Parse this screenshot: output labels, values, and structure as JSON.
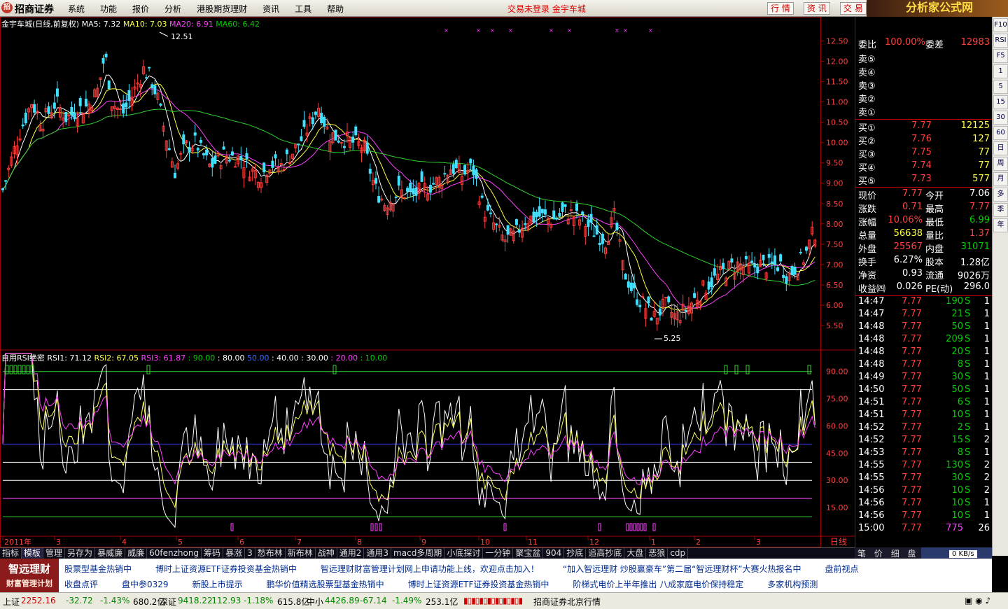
{
  "app": {
    "brand": "招商证券",
    "menu": [
      "系统",
      "功能",
      "报价",
      "分析",
      "港股期货理财",
      "资讯",
      "工具",
      "帮助"
    ],
    "status": "交易未登录  金宇车城",
    "buttons": [
      "行 情",
      "资 讯",
      "交 易"
    ],
    "ad_title": "分析家公式网",
    "ad_url": "www.88gs.com"
  },
  "kline": {
    "header": "金宇车城(日线,前复权)",
    "ma5": "MA5: 7.32",
    "ma10": "MA10: 7.03",
    "ma20": "MA20: 6.91",
    "ma60": "MA60: 6.42",
    "high_label": "12.51",
    "low_label": "5.25",
    "price_ticks": [
      "12.50",
      "12.00",
      "11.50",
      "11.00",
      "10.50",
      "10.00",
      "9.50",
      "9.00",
      "8.50",
      "8.00",
      "7.50",
      "7.00",
      "6.50",
      "6.00",
      "5.50"
    ],
    "colors": {
      "up": "#ff3c3c",
      "down": "#40e0ff",
      "ma5": "#ffffff",
      "ma10": "#ffff40",
      "ma20": "#ff40ff",
      "ma60": "#30d030"
    }
  },
  "rsi": {
    "name": "自用RSI绝密",
    "rsi1": "RSI1: 71.12",
    "rsi2": "RSI2: 67.05",
    "rsi3": "RSI3: 61.87",
    "levels": [
      ": 90.00",
      ": 80.00",
      "50.00",
      ": 40.00",
      ": 30.00",
      ": 20.00",
      ": 10.00"
    ],
    "ticks": [
      "90.00",
      "75.00",
      "60.00",
      "45.00",
      "30.00",
      "15.00"
    ]
  },
  "time_axis": [
    "2011年",
    "3",
    "4",
    "5",
    "6",
    "7",
    "8",
    "9",
    "10",
    "11",
    "12",
    "1",
    "2",
    "3"
  ],
  "time_axis_right": "日线",
  "side": {
    "weibi_label": "委比",
    "weibi": "100.00%",
    "weicha_label": "委差",
    "weicha": "12983",
    "sell": [
      {
        "label": "卖⑤"
      },
      {
        "label": "卖④"
      },
      {
        "label": "卖③"
      },
      {
        "label": "卖②"
      },
      {
        "label": "卖①"
      }
    ],
    "buy": [
      {
        "label": "买①",
        "price": "7.77",
        "vol": "12125"
      },
      {
        "label": "买②",
        "price": "7.76",
        "vol": "127"
      },
      {
        "label": "买③",
        "price": "7.75",
        "vol": "77"
      },
      {
        "label": "买④",
        "price": "7.74",
        "vol": "77"
      },
      {
        "label": "买⑤",
        "price": "7.73",
        "vol": "577"
      }
    ],
    "stats": [
      {
        "l1": "现价",
        "v1": "7.77",
        "l2": "今开",
        "v2": "7.06",
        "c1": "red",
        "c2": "wht"
      },
      {
        "l1": "涨跌",
        "v1": "0.71",
        "l2": "最高",
        "v2": "7.77",
        "c1": "red",
        "c2": "red"
      },
      {
        "l1": "涨幅",
        "v1": "10.06%",
        "l2": "最低",
        "v2": "6.99",
        "c1": "red",
        "c2": "grn"
      },
      {
        "l1": "总量",
        "v1": "56638",
        "l2": "量比",
        "v2": "1.37",
        "c1": "yel",
        "c2": "red"
      },
      {
        "l1": "外盘",
        "v1": "25567",
        "l2": "内盘",
        "v2": "31071",
        "c1": "red",
        "c2": "grn"
      },
      {
        "l1": "换手",
        "v1": "6.27%",
        "l2": "股本",
        "v2": "1.28亿",
        "c1": "wht",
        "c2": "wht"
      },
      {
        "l1": "净资",
        "v1": "0.93",
        "l2": "流通",
        "v2": "9026万",
        "c1": "wht",
        "c2": "wht"
      },
      {
        "l1": "收益㈣",
        "v1": "0.026",
        "l2": "PE(动)",
        "v2": "296.0",
        "c1": "wht",
        "c2": "wht"
      }
    ],
    "ticks": [
      {
        "t": "14:47",
        "p": "7.77",
        "v": "190",
        "s": "S",
        "n": "1"
      },
      {
        "t": "14:47",
        "p": "7.77",
        "v": "21",
        "s": "S",
        "n": "1"
      },
      {
        "t": "14:48",
        "p": "7.77",
        "v": "50",
        "s": "S",
        "n": "1"
      },
      {
        "t": "14:48",
        "p": "7.77",
        "v": "209",
        "s": "S",
        "n": "1"
      },
      {
        "t": "14:48",
        "p": "7.77",
        "v": "20",
        "s": "S",
        "n": "1"
      },
      {
        "t": "14:48",
        "p": "7.77",
        "v": "8",
        "s": "S",
        "n": "1"
      },
      {
        "t": "14:49",
        "p": "7.77",
        "v": "30",
        "s": "S",
        "n": "1"
      },
      {
        "t": "14:50",
        "p": "7.77",
        "v": "50",
        "s": "S",
        "n": "1"
      },
      {
        "t": "14:51",
        "p": "7.77",
        "v": "6",
        "s": "S",
        "n": "1"
      },
      {
        "t": "14:51",
        "p": "7.77",
        "v": "10",
        "s": "S",
        "n": "1"
      },
      {
        "t": "14:52",
        "p": "7.77",
        "v": "2",
        "s": "S",
        "n": "1"
      },
      {
        "t": "14:52",
        "p": "7.77",
        "v": "15",
        "s": "S",
        "n": "2"
      },
      {
        "t": "14:53",
        "p": "7.77",
        "v": "8",
        "s": "S",
        "n": "1"
      },
      {
        "t": "14:55",
        "p": "7.77",
        "v": "130",
        "s": "S",
        "n": "2"
      },
      {
        "t": "14:55",
        "p": "7.77",
        "v": "30",
        "s": "S",
        "n": "2"
      },
      {
        "t": "14:56",
        "p": "7.77",
        "v": "10",
        "s": "S",
        "n": "2"
      },
      {
        "t": "14:56",
        "p": "7.77",
        "v": "10",
        "s": "S",
        "n": "1"
      },
      {
        "t": "14:56",
        "p": "7.77",
        "v": "10",
        "s": "S",
        "n": "1"
      },
      {
        "t": "15:00",
        "p": "7.77",
        "v": "775",
        "s": "",
        "n": "26"
      }
    ]
  },
  "right_toolbar": [
    "F10",
    "RSI",
    "F5",
    "1",
    "5",
    "15",
    "30",
    "60",
    "日",
    "周",
    "月",
    "多",
    "季",
    "年"
  ],
  "bottom_tabs": [
    "指标",
    "模板",
    "管理",
    "另存为",
    "暴威廉",
    "威廉",
    "60fenzhong",
    "筹码",
    "暴涨",
    "3",
    "愁布林",
    "新布林",
    "战神",
    "通用2",
    "通用3",
    "macd多周期",
    "小底探讨",
    "一分钟",
    "聚宝盆",
    "904",
    "抄底",
    "追高抄底",
    "大盘",
    "恶狼",
    "cdp"
  ],
  "side_tabs": [
    "笔",
    "价",
    "细",
    "盘"
  ],
  "speed": "0 KB/s",
  "news": {
    "logo": "智远理财",
    "logo_sub": "财富管理计划",
    "line1": [
      "股票型基金热销中",
      "博时上证资源ETF证券投资基金热销中",
      "智远理财财富管理计划网上申请功能上线，欢迎点击加入！",
      "“加入智远理财 炒股赢豪车”第二届“智远理财杯”大赛火热报名中",
      "盘前视点"
    ],
    "line2": [
      "收盘点评",
      "盘中参0329",
      "新股上市提示",
      "鹏华价值精选股票型基金热销中",
      "博时上证资源ETF证券投资基金热销中",
      "阶梯式电价上半年推出 八成家庭电价保持稳定",
      "多家机构预测"
    ]
  },
  "statusbar": {
    "sh_label": "上证",
    "sh": "2252.16",
    "sh_chg": "-32.72",
    "sh_pct": "-1.43%",
    "sh_amt": "680.2亿",
    "sz_label": "深证",
    "sz": "9418.22",
    "sz_chg": "-112.93",
    "sz_pct": "-1.18%",
    "sz_amt": "615.8亿",
    "zx_label": "中小",
    "zx": "4426.89",
    "zx_chg": "-67.14",
    "zx_pct": "-1.49%",
    "zx_amt": "253.1亿",
    "server": "招商证券北京行情"
  }
}
